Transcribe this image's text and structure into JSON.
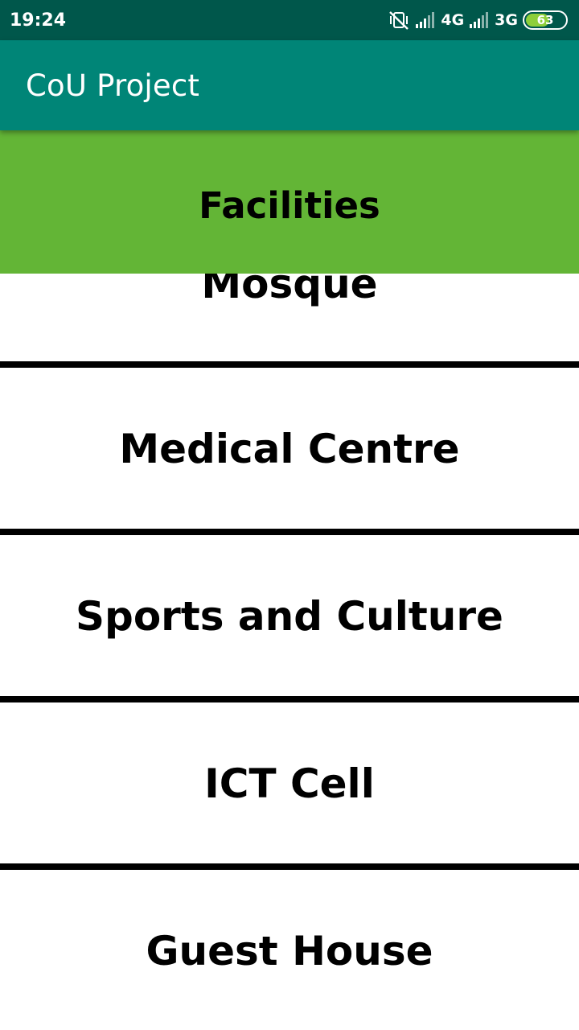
{
  "status_bar": {
    "time": "19:24",
    "icons": [
      "vibrate-off-icon",
      "signal-icon",
      "signal-icon"
    ],
    "network_1": "4G",
    "network_2": "3G",
    "battery": "63",
    "battery_level_percent": 63
  },
  "app_bar": {
    "title": "CoU Project",
    "color": "#008577"
  },
  "header": {
    "label": "Facilities",
    "color": "#63b536"
  },
  "list": {
    "items": [
      {
        "label": "Mosque"
      },
      {
        "label": "Medical Centre"
      },
      {
        "label": "Sports and Culture"
      },
      {
        "label": "ICT Cell"
      },
      {
        "label": "Guest House"
      }
    ]
  }
}
